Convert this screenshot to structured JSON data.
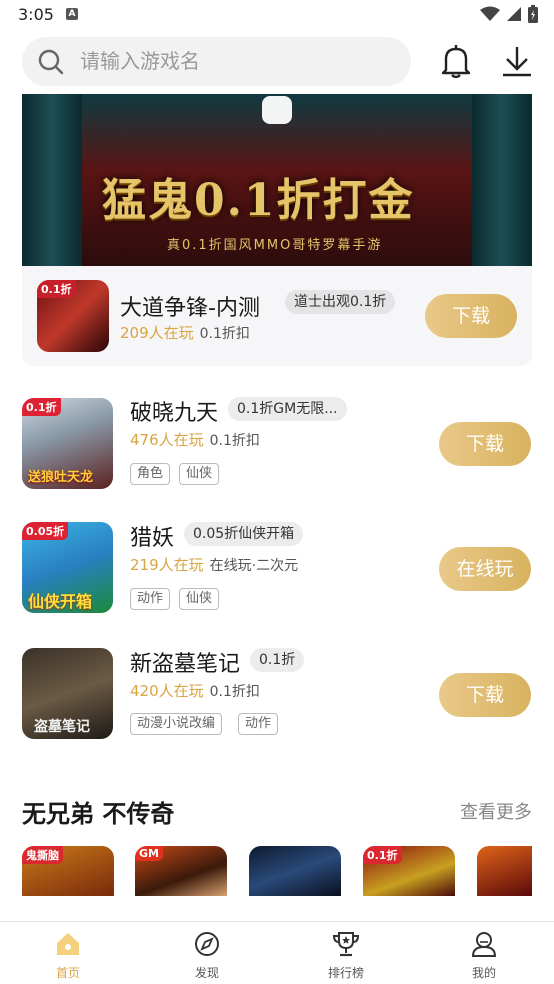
{
  "status": {
    "time": "3:05",
    "a_badge": "A"
  },
  "search": {
    "placeholder": "请输入游戏名"
  },
  "banner": {
    "title": "猛鬼0.1折打金",
    "subtitle": "真0.1折国风MMO哥特罗幕手游"
  },
  "featured": {
    "name": "大道争锋-内测",
    "tag": "道士出观0.1折",
    "playing": "209人在玩",
    "discount": "0.1折扣",
    "thumb_badge": "0.1折",
    "button": "下载"
  },
  "games": [
    {
      "name": "破晓九天",
      "tag": "0.1折GM无限...",
      "playing": "476人在玩",
      "discount": "0.1折扣",
      "chips": [
        "角色",
        "仙侠"
      ],
      "button": "下载",
      "thumb_badge": "0.1折",
      "thumb_text": "送狼吐天龙"
    },
    {
      "name": "猎妖",
      "tag": "0.05折仙侠开箱",
      "playing": "219人在玩",
      "discount": "在线玩·二次元",
      "chips": [
        "动作",
        "仙侠"
      ],
      "button": "在线玩",
      "thumb_badge": "0.05折",
      "thumb_text": "仙侠开箱"
    },
    {
      "name": "新盗墓笔记",
      "tag": "0.1折",
      "playing": "420人在玩",
      "discount": "0.1折扣",
      "chips": [
        "动漫小说改编",
        "动作"
      ],
      "button": "下载",
      "thumb_badge": "",
      "thumb_text": "盗墓笔记"
    }
  ],
  "section": {
    "title": "无兄弟  不传奇",
    "more": "查看更多",
    "mini_badges": [
      "鬼撕脑",
      "GM",
      "",
      "0.1折",
      ""
    ]
  },
  "nav": [
    {
      "label": "首页",
      "icon": "home-icon",
      "active": true
    },
    {
      "label": "发现",
      "icon": "compass-icon",
      "active": false
    },
    {
      "label": "排行榜",
      "icon": "trophy-icon",
      "active": false
    },
    {
      "label": "我的",
      "icon": "user-icon",
      "active": false
    }
  ],
  "colors": {
    "accent": "#d9a441",
    "button": "#e2c078"
  }
}
